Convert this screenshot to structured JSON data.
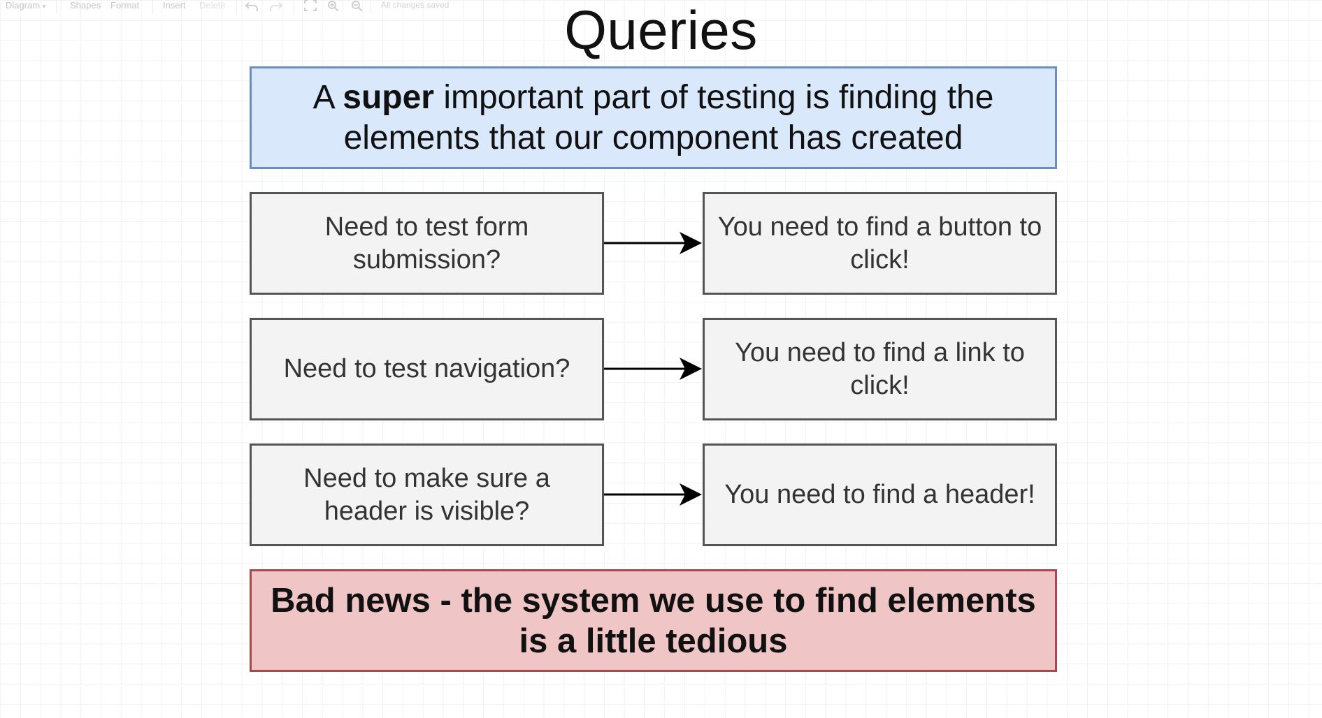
{
  "toolbar": {
    "diagram_menu": "Diagram",
    "shapes": "Shapes",
    "format": "Format",
    "insert": "Insert",
    "delete": "Delete",
    "status": "All changes saved"
  },
  "slide": {
    "title": "Queries",
    "intro": {
      "prefix": "A ",
      "emphasis": "super",
      "suffix": " important part of testing is finding the elements that our component has created"
    },
    "rows": [
      {
        "question": "Need to test form submission?",
        "answer": "You need to find a button to click!"
      },
      {
        "question": "Need to test navigation?",
        "answer": "You need to find a link to click!"
      },
      {
        "question": "Need to make sure a header is visible?",
        "answer": "You need to find a header!"
      }
    ],
    "bad_news": "Bad news - the system we use to find elements is a little tedious"
  },
  "colors": {
    "intro_fill": "#dae8fc",
    "intro_border": "#6c8ebf",
    "box_fill": "#f3f3f3",
    "box_border": "#555555",
    "bad_fill": "#f0c5c5",
    "bad_border": "#a8484b"
  },
  "icons": {
    "undo": "undo-icon",
    "redo": "redo-icon",
    "fit": "fit-page-icon",
    "zoom_in": "zoom-in-icon",
    "zoom_out": "zoom-out-icon",
    "dropdown": "chevron-down-icon",
    "arrow": "arrow-right-icon"
  }
}
